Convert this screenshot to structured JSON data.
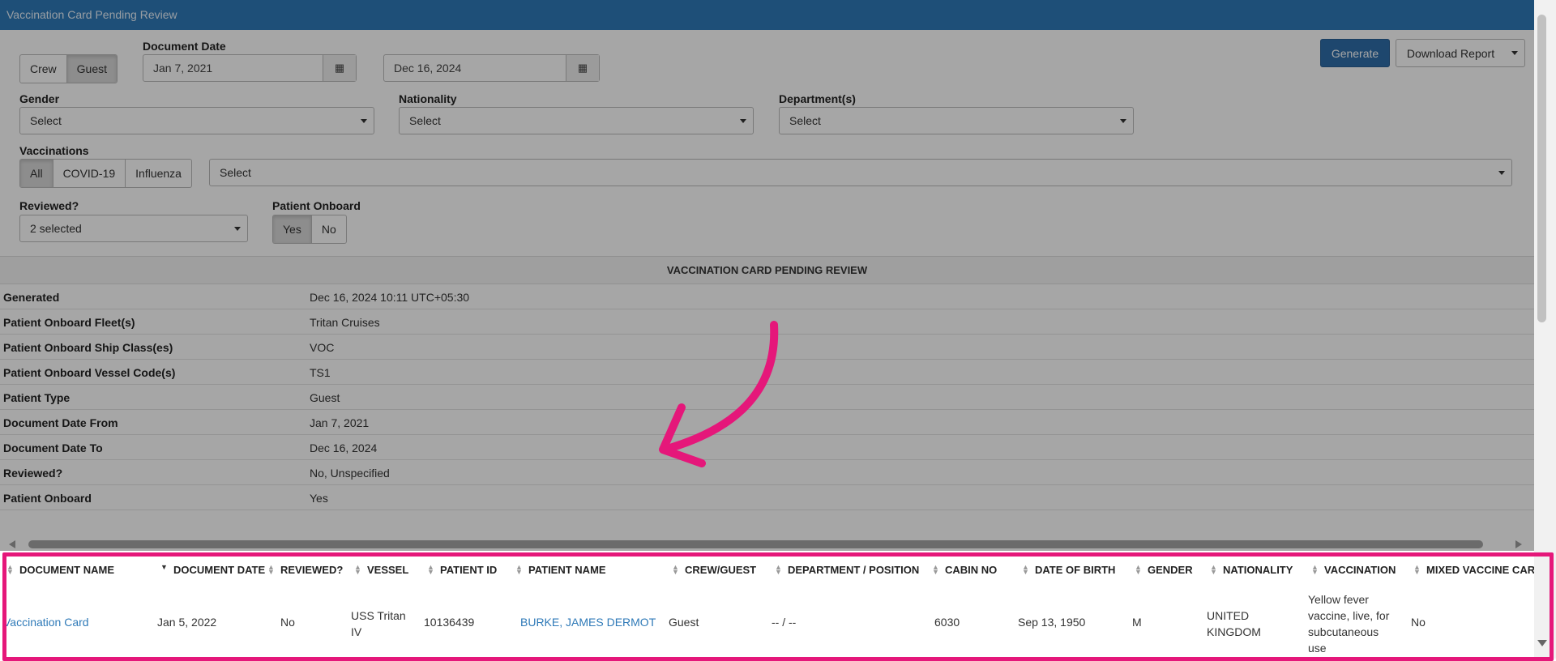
{
  "window": {
    "title": "Vaccination Card Pending Review"
  },
  "filters": {
    "patient_type": {
      "options": [
        "Crew",
        "Guest"
      ],
      "active": "Guest"
    },
    "document_date": {
      "label": "Document Date",
      "from": "Jan 7, 2021",
      "to": "Dec 16, 2024",
      "icon": "calendar-icon"
    },
    "gender": {
      "label": "Gender",
      "value": "Select"
    },
    "nationality": {
      "label": "Nationality",
      "value": "Select"
    },
    "departments": {
      "label": "Department(s)",
      "value": "Select"
    },
    "vaccinations": {
      "label": "Vaccinations",
      "options": [
        "All",
        "COVID-19",
        "Influenza"
      ],
      "active": "All",
      "select_value": "Select"
    },
    "reviewed": {
      "label": "Reviewed?",
      "value": "2 selected"
    },
    "patient_onboard": {
      "label": "Patient Onboard",
      "options": [
        "Yes",
        "No"
      ],
      "active": "Yes"
    }
  },
  "actions": {
    "generate": "Generate",
    "download": "Download Report"
  },
  "report": {
    "heading": "VACCINATION CARD PENDING REVIEW",
    "rows": [
      {
        "key": "Generated",
        "value": "Dec 16, 2024 10:11 UTC+05:30"
      },
      {
        "key": "Patient Onboard Fleet(s)",
        "value": "Tritan Cruises"
      },
      {
        "key": "Patient Onboard Ship Class(es)",
        "value": "VOC"
      },
      {
        "key": "Patient Onboard Vessel Code(s)",
        "value": "TS1"
      },
      {
        "key": "Patient Type",
        "value": "Guest"
      },
      {
        "key": "Document Date From",
        "value": "Jan 7, 2021"
      },
      {
        "key": "Document Date To",
        "value": "Dec 16, 2024"
      },
      {
        "key": "Reviewed?",
        "value": "No, Unspecified"
      },
      {
        "key": "Patient Onboard",
        "value": "Yes"
      }
    ]
  },
  "table": {
    "columns": [
      "DOCUMENT NAME",
      "DOCUMENT DATE",
      "REVIEWED?",
      "VESSEL",
      "PATIENT ID",
      "PATIENT NAME",
      "CREW/GUEST",
      "DEPARTMENT / POSITION",
      "CABIN NO",
      "DATE OF BIRTH",
      "GENDER",
      "NATIONALITY",
      "VACCINATION",
      "MIXED VACCINE CAR"
    ],
    "rows": [
      {
        "document_name": "Vaccination Card",
        "document_date": "Jan 5, 2022",
        "reviewed": "No",
        "vessel": "USS Tritan IV",
        "patient_id": "10136439",
        "patient_name": "BURKE, JAMES DERMOT",
        "crew_guest": "Guest",
        "department": "-- / --",
        "cabin_no": "6030",
        "dob": "Sep 13, 1950",
        "gender": "M",
        "nationality": "UNITED KINGDOM",
        "vaccination": "Yellow fever vaccine, live, for subcutaneous use",
        "mixed": "No"
      }
    ]
  },
  "annotation": {
    "color": "#e5177a"
  }
}
